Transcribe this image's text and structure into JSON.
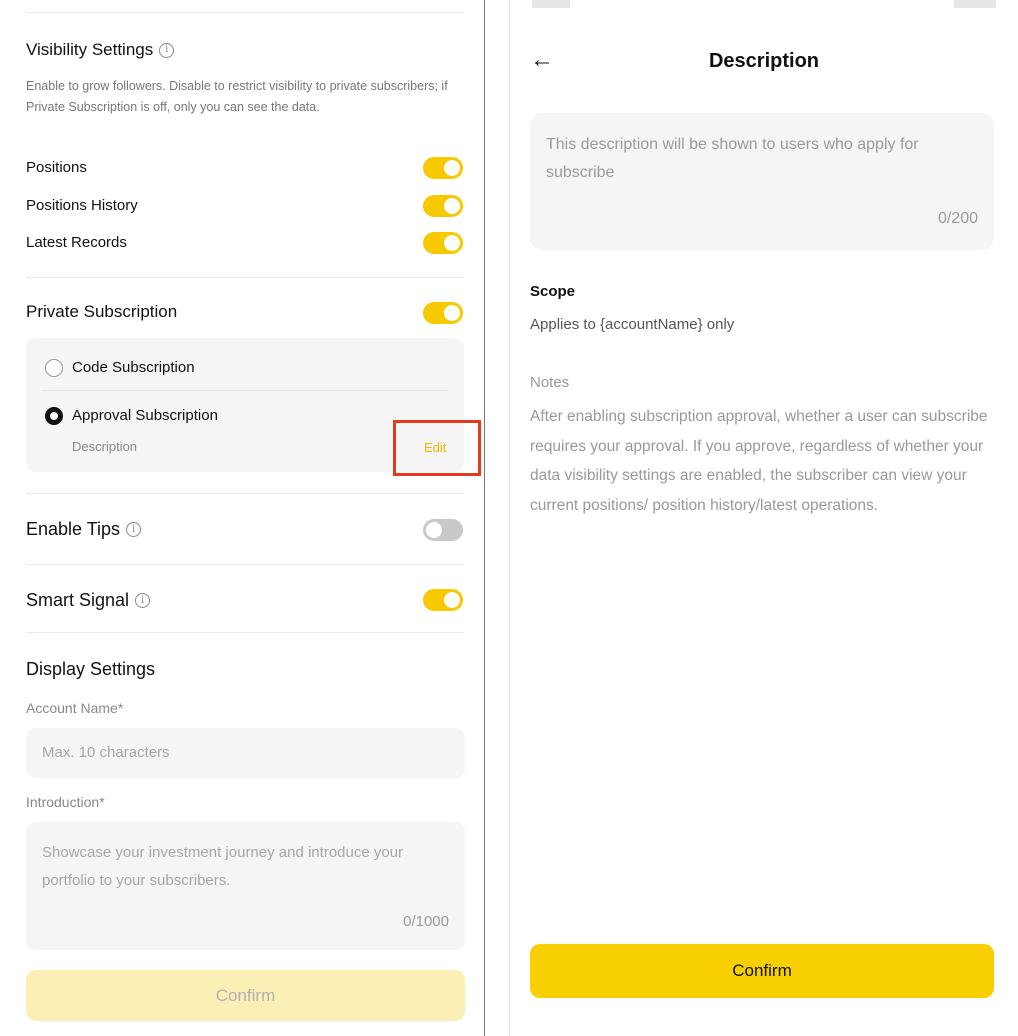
{
  "left": {
    "visibility": {
      "title": "Visibility Settings",
      "description": "Enable to grow followers. Disable to restrict visibility to private subscribers; if Private Subscription is off, only you can see the data.",
      "items": [
        {
          "label": "Positions",
          "on": true
        },
        {
          "label": "Positions History",
          "on": true
        },
        {
          "label": "Latest Records",
          "on": true
        }
      ]
    },
    "private_subscription": {
      "label": "Private Subscription",
      "on": true,
      "code_label": "Code Subscription",
      "approval_label": "Approval Subscription",
      "approval_description": "Description",
      "edit_label": "Edit"
    },
    "enable_tips": {
      "label": "Enable Tips",
      "on": false
    },
    "smart_signal": {
      "label": "Smart Signal",
      "on": true
    },
    "display_settings": {
      "title": "Display Settings",
      "account_name_label": "Account Name*",
      "account_name_placeholder": "Max. 10 characters",
      "introduction_label": "Introduction*",
      "introduction_placeholder": "Showcase your investment journey and introduce your portfolio to your subscribers.",
      "introduction_counter": "0/1000"
    },
    "confirm_label": "Confirm"
  },
  "right": {
    "title": "Description",
    "back_icon": "arrow-left-icon",
    "textarea_placeholder": "This description will be shown to users who apply for subscribe",
    "textarea_counter": "0/200",
    "scope_label": "Scope",
    "scope_value": "Applies to {accountName} only",
    "notes_label": "Notes",
    "notes_text": "After enabling subscription approval, whether a user can subscribe requires your approval. If you approve, regardless of whether your data visibility settings are enabled, the subscriber can view your current positions/ position history/latest operations.",
    "confirm_label": "Confirm"
  },
  "colors": {
    "accent": "#f8cf00",
    "highlight_box": "#e63a1d",
    "edit_link": "#f0b400"
  }
}
